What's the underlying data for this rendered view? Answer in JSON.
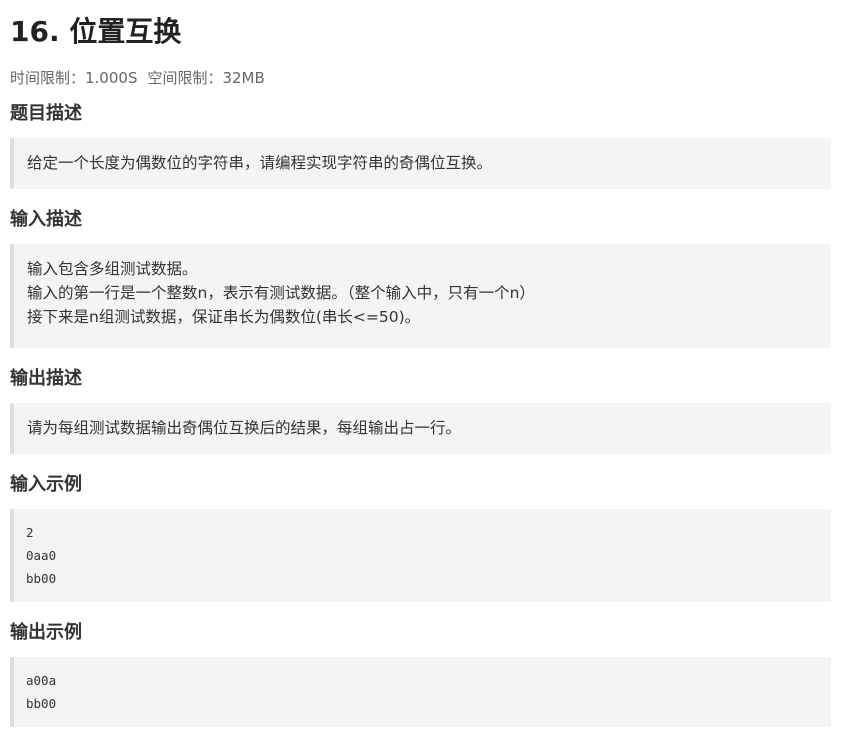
{
  "problem": {
    "title": "16. 位置互换",
    "time_limit": "时间限制：1.000S",
    "memory_limit": "空间限制：32MB"
  },
  "sections": {
    "description": {
      "heading": "题目描述",
      "lines": [
        "给定一个长度为偶数位的字符串，请编程实现字符串的奇偶位互换。"
      ]
    },
    "input": {
      "heading": "输入描述",
      "lines": [
        "输入包含多组测试数据。",
        "输入的第一行是一个整数n，表示有测试数据。（整个输入中，只有一个n）",
        "接下来是n组测试数据，保证串长为偶数位(串长<=50)。"
      ]
    },
    "output": {
      "heading": "输出描述",
      "lines": [
        "请为每组测试数据输出奇偶位互换后的结果，每组输出占一行。"
      ]
    },
    "sample_input": {
      "heading": "输入示例",
      "lines": [
        "2",
        "0aa0",
        "bb00"
      ]
    },
    "sample_output": {
      "heading": "输出示例",
      "lines": [
        "a00a",
        "bb00"
      ]
    }
  }
}
